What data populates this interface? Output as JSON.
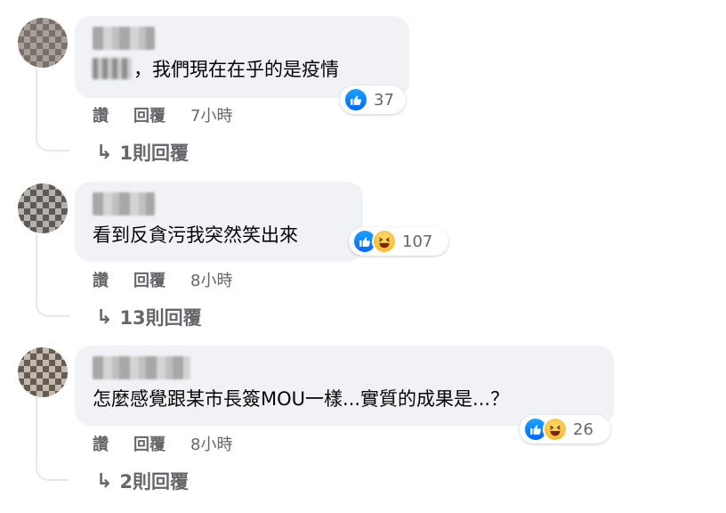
{
  "comments": [
    {
      "text": "，我們現在在乎的是疫情",
      "reaction_count": "37",
      "actions": {
        "like": "讚",
        "reply": "回覆",
        "time": "7小時"
      },
      "replies_label": "1則回覆"
    },
    {
      "text": "看到反貪污我突然笑出來",
      "reaction_count": "107",
      "actions": {
        "like": "讚",
        "reply": "回覆",
        "time": "8小時"
      },
      "replies_label": "13則回覆"
    },
    {
      "text": "怎麼感覺跟某市長簽MOU一樣...實質的成果是...？",
      "reaction_count": "26",
      "actions": {
        "like": "讚",
        "reply": "回覆",
        "time": "8小時"
      },
      "replies_label": "2則回覆"
    }
  ],
  "reply_arrow": "↳",
  "colors": {
    "bubble": "#f0f2f5",
    "meta": "#65676b",
    "like": "#0866ff",
    "haha": "#f7b125"
  }
}
